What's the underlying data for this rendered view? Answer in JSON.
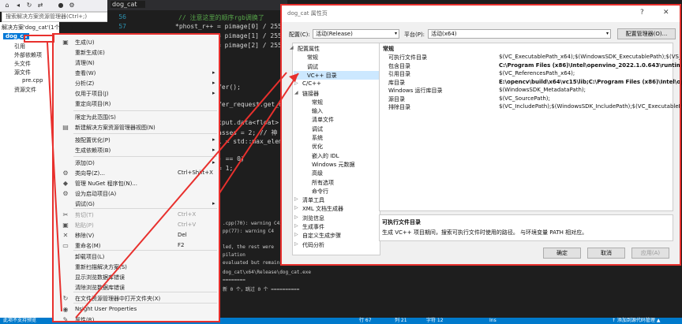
{
  "toolbar": {
    "icons": [
      "home-icon",
      "back-icon",
      "refresh-icon",
      "sync-icon",
      "pin-icon",
      "settings-icon"
    ]
  },
  "editor_tab": {
    "title": "dog_cat"
  },
  "solution_explorer": {
    "search_placeholder": "搜索解决方案资源管理器(Ctrl+;)",
    "solution_label": "解决方案'dog_cat'(1个项目)",
    "project": "dog_ca",
    "items": [
      "引用",
      "外部依赖项",
      "头文件",
      "源文件",
      "pre.cpp",
      "资源文件"
    ]
  },
  "editor": {
    "lines": [
      {
        "n": "56",
        "code": "// 注意这里的顺序rgb调换了"
      },
      {
        "n": "57",
        "code": "*phost_r++ = pimage[0] / 255.0"
      },
      {
        "n": "58",
        "code": "*phost_g++ = pimage[1] / 255.0"
      },
      {
        "n": "59",
        "code": "*phost_b++ = pimage[2] / 255.0"
      },
      {
        "n": "60",
        "code": "}"
      }
    ],
    "lines2": [
      "fer();",
      "fer_request.get_o",
      "tput.data<float>",
      "asses = 2; // 神",
      "l = std::max_elem",
      ") == 0)",
      "= 1;"
    ]
  },
  "output": {
    "lines": [
      ".cpp(70): warning C4244",
      "pp(77): warning C4",
      "led, the rest were",
      "pilation",
      "evaluated but remain",
      "dog_cat\\x64\\Release\\dog_cat.exe",
      "========",
      "新 0 个，跳过 0 个 =========="
    ]
  },
  "status": {
    "left": "此项不支持预览",
    "ln": "行 67",
    "col": "列 21",
    "ch": "字符 12",
    "mode": "Ins",
    "right": "↑ 添加到源代码管理 ▲"
  },
  "context_menu": {
    "items": [
      {
        "label": "生成(U)",
        "icon": "build-icon"
      },
      {
        "label": "重新生成(E)",
        "icon": ""
      },
      {
        "label": "清理(N)",
        "icon": ""
      },
      {
        "label": "查看(W)",
        "icon": "",
        "sub": true
      },
      {
        "label": "分析(Z)",
        "icon": "",
        "sub": true
      },
      {
        "label": "仅用于项目(J)",
        "icon": "",
        "sub": true
      },
      {
        "label": "重定向项目(R)",
        "icon": ""
      },
      {
        "label": "限定为此范围(S)",
        "icon": ""
      },
      {
        "label": "新建解决方案资源管理器视图(N)",
        "icon": "new-view-icon"
      },
      {
        "label": "按配置优化(P)",
        "icon": "",
        "sub": true
      },
      {
        "label": "生成依赖项(B)",
        "icon": "",
        "sub": true
      },
      {
        "label": "添加(D)",
        "icon": "",
        "sub": true
      },
      {
        "label": "类向导(Z)...",
        "icon": "class-wizard-icon",
        "shortcut": "Ctrl+Shift+X"
      },
      {
        "label": "管理 NuGet 程序包(N)...",
        "icon": "nuget-icon"
      },
      {
        "label": "设为启动项目(A)",
        "icon": "gear-icon"
      },
      {
        "label": "调试(G)",
        "icon": "",
        "sub": true
      },
      {
        "label": "剪切(T)",
        "icon": "cut-icon",
        "shortcut": "Ctrl+X"
      },
      {
        "label": "粘贴(P)",
        "icon": "paste-icon",
        "shortcut": "Ctrl+V"
      },
      {
        "label": "移除(V)",
        "icon": "remove-icon",
        "shortcut": "Del"
      },
      {
        "label": "重命名(M)",
        "icon": "rename-icon",
        "shortcut": "F2"
      },
      {
        "label": "卸载项目(L)",
        "icon": ""
      },
      {
        "label": "重新扫描解决方案(S)",
        "icon": ""
      },
      {
        "label": "显示浏览数据库错误",
        "icon": ""
      },
      {
        "label": "清除浏览数据库错误",
        "icon": ""
      },
      {
        "label": "在文件资源管理器中打开文件夹(X)",
        "icon": "folder-open-icon"
      },
      {
        "label": "Nsight User Properties",
        "icon": "nsight-icon"
      },
      {
        "label": "属性(R)",
        "icon": "wrench-icon"
      }
    ]
  },
  "dialog": {
    "title": "dog_cat 属性页",
    "help": "?",
    "close": "✕",
    "config_label": "配置(C):",
    "config_value": "活动(Release)",
    "platform_label": "平台(P):",
    "platform_value": "活动(x64)",
    "config_manager": "配置管理器(O)...",
    "tree": [
      {
        "label": "配置属性",
        "arrow": "◢"
      },
      {
        "label": "常规",
        "arrow": ""
      },
      {
        "label": "调试",
        "arrow": ""
      },
      {
        "label": "VC++ 目录",
        "arrow": ""
      },
      {
        "label": "C/C++",
        "arrow": "▷"
      },
      {
        "label": "链接器",
        "arrow": "◢"
      },
      {
        "label": "常规",
        "arrow": ""
      },
      {
        "label": "输入",
        "arrow": ""
      },
      {
        "label": "清单文件",
        "arrow": ""
      },
      {
        "label": "调试",
        "arrow": ""
      },
      {
        "label": "系统",
        "arrow": ""
      },
      {
        "label": "优化",
        "arrow": ""
      },
      {
        "label": "嵌入的 IDL",
        "arrow": ""
      },
      {
        "label": "Windows 元数据",
        "arrow": ""
      },
      {
        "label": "高级",
        "arrow": ""
      },
      {
        "label": "所有选项",
        "arrow": ""
      },
      {
        "label": "命令行",
        "arrow": ""
      },
      {
        "label": "清单工具",
        "arrow": "▷"
      },
      {
        "label": "XML 文档生成器",
        "arrow": "▷"
      },
      {
        "label": "浏览信息",
        "arrow": "▷"
      },
      {
        "label": "生成事件",
        "arrow": "▷"
      },
      {
        "label": "自定义生成步骤",
        "arrow": "▷"
      },
      {
        "label": "代码分析",
        "arrow": "▷"
      }
    ],
    "section": "常规",
    "props": [
      {
        "name": "可执行文件目录",
        "value": "$(VC_ExecutablePath_x64);$(WindowsSDK_ExecutablePath);$(VS_",
        "bold": false
      },
      {
        "name": "包含目录",
        "value": "C:\\Program Files (x86)\\Intel\\openvino_2022.1.0.643\\runtime\\in",
        "bold": true
      },
      {
        "name": "引用目录",
        "value": "$(VC_ReferencesPath_x64);",
        "bold": false
      },
      {
        "name": "库目录",
        "value": "E:\\opencv\\build\\x64\\vc15\\lib;C:\\Program Files (x86)\\Intel\\ope",
        "bold": true
      },
      {
        "name": "Windows 运行库目录",
        "value": "$(WindowsSDK_MetadataPath);",
        "bold": false
      },
      {
        "name": "源目录",
        "value": "$(VC_SourcePath);",
        "bold": false
      },
      {
        "name": "排除目录",
        "value": "$(VC_IncludePath);$(WindowsSDK_IncludePath);$(VC_ExecutablePa",
        "bold": false
      }
    ],
    "desc_title": "可执行文件目录",
    "desc_text": "生成 VC++ 项目期间，搜索可执行文件时使用的路径。 与环境变量 PATH 相对应。",
    "ok": "确定",
    "cancel": "取消",
    "apply": "应用(A)"
  },
  "colors": {
    "highlight": "#e8302d",
    "accent": "#007acc"
  }
}
